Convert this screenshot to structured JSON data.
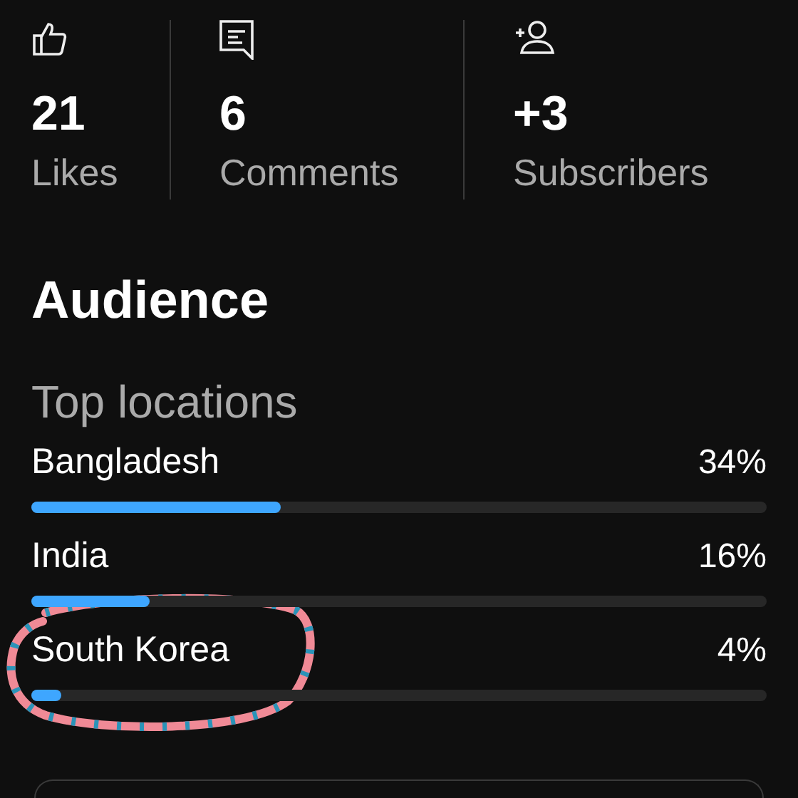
{
  "stats": [
    {
      "kind": "likes",
      "value": "21",
      "label": "Likes"
    },
    {
      "kind": "comments",
      "value": "6",
      "label": "Comments"
    },
    {
      "kind": "subscribers",
      "value": "+3",
      "label": "Subscribers"
    }
  ],
  "audience": {
    "title": "Audience",
    "subtitle": "Top locations",
    "locations": [
      {
        "name": "Bangladesh",
        "reading": "34%",
        "level": 0.34,
        "annotated": false
      },
      {
        "name": "India",
        "reading": "16%",
        "level": 0.16,
        "annotated": false
      },
      {
        "name": "South Korea",
        "reading": "4%",
        "level": 0.04,
        "annotated": true
      }
    ]
  }
}
